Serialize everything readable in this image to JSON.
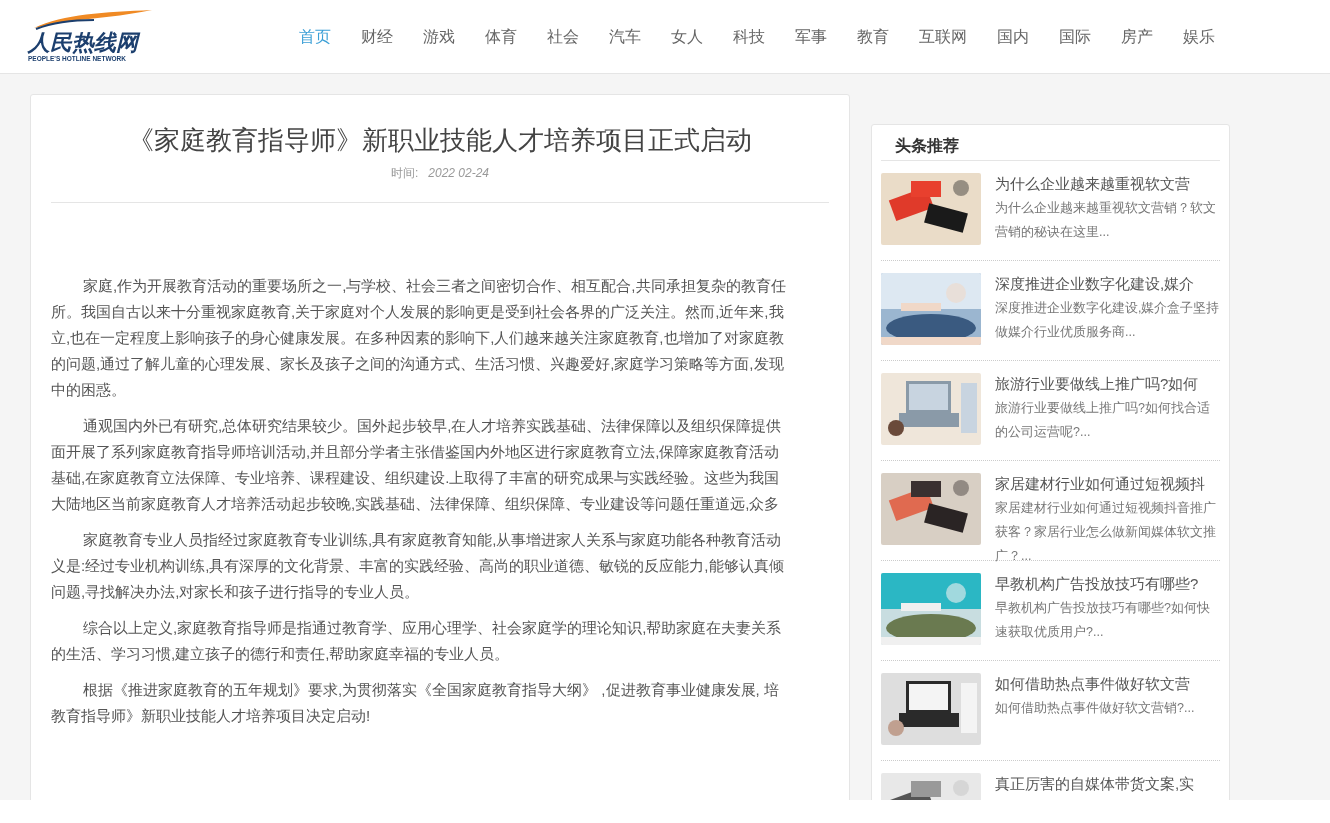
{
  "logo": {
    "name": "人民热线网",
    "tagline": "PEOPLE'S HOTLINE NETWORK"
  },
  "nav": [
    {
      "label": "首页",
      "selected": true
    },
    {
      "label": "财经",
      "selected": false
    },
    {
      "label": "游戏",
      "selected": false
    },
    {
      "label": "体育",
      "selected": false
    },
    {
      "label": "社会",
      "selected": false
    },
    {
      "label": "汽车",
      "selected": false
    },
    {
      "label": "女人",
      "selected": false
    },
    {
      "label": "科技",
      "selected": false
    },
    {
      "label": "军事",
      "selected": false
    },
    {
      "label": "教育",
      "selected": false
    },
    {
      "label": "互联网",
      "selected": false
    },
    {
      "label": "国内",
      "selected": false
    },
    {
      "label": "国际",
      "selected": false
    },
    {
      "label": "房产",
      "selected": false
    },
    {
      "label": "娱乐",
      "selected": false
    }
  ],
  "article": {
    "title": "《家庭教育指导师》新职业技能人才培养项目正式启动",
    "time_label": "时间:",
    "date": "2022 02-24",
    "paragraphs": [
      [
        "家庭,作为开展教育活动的重要场所之一,与学校、社会三者之间密切合作、相互配合,共同承担复杂的教育任",
        "所。我国自古以来十分重视家庭教育,关于家庭对个人发展的影响更是受到社会各界的广泛关注。然而,近年来,我",
        "立,也在一定程度上影响孩子的身心健康发展。在多种因素的影响下,人们越来越关注家庭教育,也增加了对家庭教",
        "的问题,通过了解儿童的心理发展、家长及孩子之间的沟通方式、生活习惯、兴趣爱好,家庭学习策略等方面,发现",
        "中的困惑。"
      ],
      [
        "通观国内外已有研究,总体研究结果较少。国外起步较早,在人才培养实践基础、法律保障以及组织保障提供",
        "面开展了系列家庭教育指导师培训活动,并且部分学者主张借鉴国内外地区进行家庭教育立法,保障家庭教育活动",
        "基础,在家庭教育立法保障、专业培养、课程建设、组织建设.上取得了丰富的研究成果与实践经验。这些为我国",
        "大陆地区当前家庭教育人才培养活动起步较晚,实践基础、法律保障、组织保障、专业建设等问题任重道远,众多"
      ],
      [
        "家庭教育专业人员指经过家庭教育专业训练,具有家庭教育知能,从事增进家人关系与家庭功能各种教育活动",
        "义是:经过专业机构训练,具有深厚的文化背景、丰富的实践经验、高尚的职业道德、敏锐的反应能力,能够认真倾",
        "问题,寻找解决办法,对家长和孩子进行指导的专业人员。"
      ],
      [
        "综合以上定义,家庭教育指导师是指通过教育学、应用心理学、社会家庭学的理论知识,帮助家庭在夫妻关系",
        "的生活、学习习惯,建立孩子的德行和责任,帮助家庭幸福的专业人员。"
      ],
      [
        "根据《推进家庭教育的五年规划》要求,为贯彻落实《全国家庭教育指导大纲》 ,促进教育事业健康发展, 培",
        "教育指导师》新职业技能人才培养项目决定启动!"
      ]
    ]
  },
  "sidebar": {
    "heading": "头条推荐",
    "items": [
      {
        "title": "为什么企业越来越重视软文营",
        "summary": "为什么企业越来越重视软文营销？软文营销的秘诀在这里..."
      },
      {
        "title": "深度推进企业数字化建设,媒介",
        "summary": "深度推进企业数字化建设,媒介盒子坚持做媒介行业优质服务商..."
      },
      {
        "title": "旅游行业要做线上推广吗?如何",
        "summary": "旅游行业要做线上推广吗?如何找合适的公司运营呢?..."
      },
      {
        "title": "家居建材行业如何通过短视频抖",
        "summary": "家居建材行业如何通过短视频抖音推广获客？家居行业怎么做新闻媒体软文推广？..."
      },
      {
        "title": "早教机构广告投放技巧有哪些?",
        "summary": "早教机构广告投放技巧有哪些?如何快速获取优质用户?..."
      },
      {
        "title": "如何借助热点事件做好软文营",
        "summary": "如何借助热点事件做好软文营销?..."
      },
      {
        "title": "真正厉害的自媒体带货文案,实"
      }
    ]
  }
}
